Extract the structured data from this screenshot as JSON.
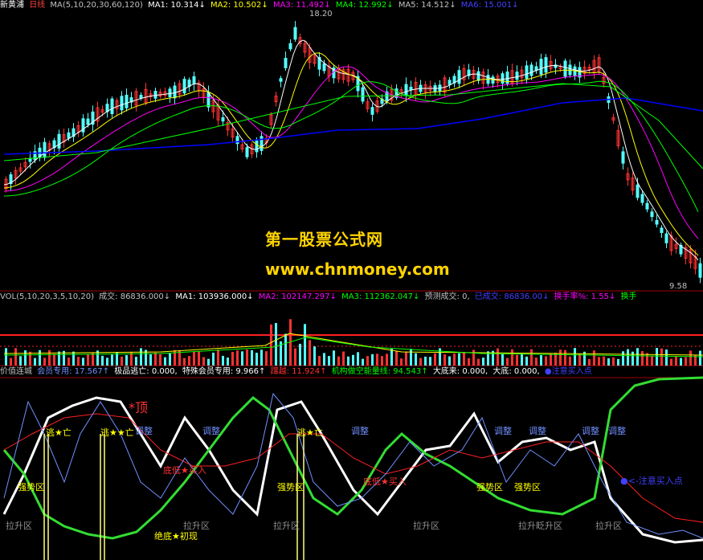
{
  "header": {
    "stock_name": "新黄浦",
    "period": "日线",
    "ma_title": "MA(5,10,20,30,60,120)",
    "ma1": "MA1: 10.314↓",
    "ma2": "MA2: 10.502↓",
    "ma3": "MA3: 11.492↓",
    "ma4": "MA4: 12.992↓",
    "ma5": "MA5: 14.512↓",
    "ma6": "MA6: 15.001↓",
    "high_label": "18.20",
    "low_label": "9.58"
  },
  "vol_bar": {
    "title": "VOL(5,10,20,3,5,10,20)",
    "vol": "成交: 86836.000↓",
    "ma1": "MA1: 103936.000↓",
    "ma2": "MA2: 102147.297↓",
    "ma3": "MA3: 112362.047↓",
    "forecast": "预测成交: 0,",
    "done": "已成交: 86836.00↓",
    "turnover": "换手率%: 1.55↓",
    "turnover2": "换手"
  },
  "ind_bar": {
    "title": "价值连城",
    "member": "会员专用: 17.567↑",
    "escape": "极品逃亡: 0.000,",
    "special": "特殊会员专用: 9.966↑",
    "jump": "蹿越: 11.924↑",
    "inst": "机构做空能量线: 94.543↑",
    "bottom_come": "大底来: 0.000,",
    "bottom": "大底: 0.000,",
    "buy_point": "●注意买入点"
  },
  "annotations": {
    "top": "*顶",
    "escape": "逃★亡",
    "escape_multi": "逃★★亡",
    "adjust": "调整",
    "bottom_buy": "底低★买入",
    "strong": "强势区",
    "rise": "拉升区",
    "rise_multi": "拉升眨升区",
    "abs_bottom": "绝底★初现",
    "buy_note": "●<-注意买入点"
  },
  "watermark": {
    "line1": "第一股票公式网",
    "line2": "www.chnmoney.com"
  },
  "colors": {
    "bg": "#000000",
    "up": "#ff3232",
    "down": "#54ffff",
    "ma1": "#ffffff",
    "ma2": "#ffff00",
    "ma3": "#ff00ff",
    "ma4": "#00ff00",
    "ma5": "#c0c0c0",
    "ma6": "#0000ff"
  }
}
